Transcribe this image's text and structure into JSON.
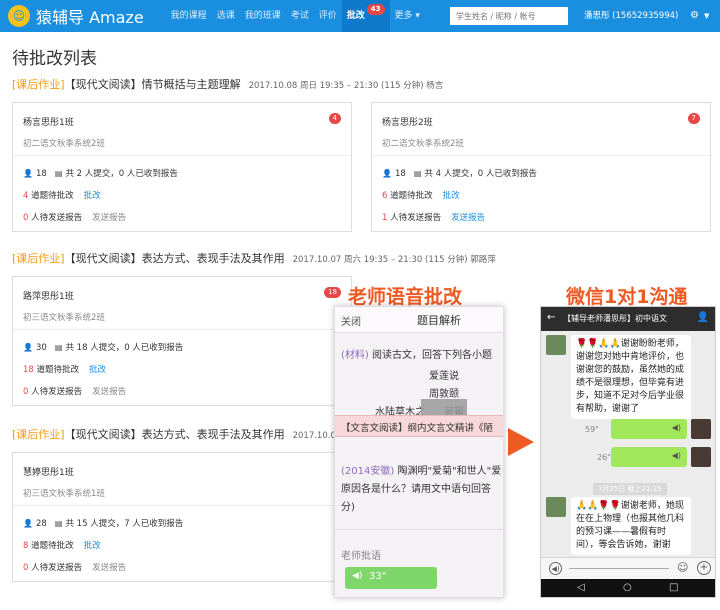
{
  "nav": {
    "logo_mark": "☺",
    "logo_text": "猿辅导 Amaze",
    "items": [
      {
        "label": "我的课程"
      },
      {
        "label": "选课"
      },
      {
        "label": "我的班课"
      },
      {
        "label": "考试"
      },
      {
        "label": "评价"
      },
      {
        "label": "批改",
        "badge": "43"
      },
      {
        "label": "更多 ▾"
      }
    ],
    "search_placeholder": "学生姓名 / 昵称 / 帐号",
    "user": "潘思彤 (15652935994)",
    "gear_icon": "gear-icon"
  },
  "page_title": "待批改列表",
  "sections": [
    {
      "tag": "[课后作业]",
      "title": "【现代文阅读】情节概括与主题理解",
      "meta": "2017.10.08 周日 19:35 – 21:30 (115 分钟)  杨言",
      "cards": [
        {
          "title": "杨言思彤1班",
          "class": "初二语文秋季系统2班",
          "badge": "4",
          "students": "18",
          "submit": "共 2 人提交，0 人已收到报告",
          "pending_num": "4",
          "pending_text": " 道题待批改",
          "grade_link": "批改",
          "send_num": "0",
          "send_text": " 人待发送报告",
          "send_link": "发送报告"
        },
        {
          "title": "杨言思彤2班",
          "class": "初二语文秋季系统2班",
          "badge": "7",
          "students": "18",
          "submit": "共 4 人提交，0 人已收到报告",
          "pending_num": "6",
          "pending_text": " 道题待批改",
          "grade_link": "批改",
          "send_num": "1",
          "send_text": " 人待发送报告",
          "send_link": "发送报告"
        }
      ]
    },
    {
      "tag": "[课后作业]",
      "title": "【现代文阅读】表达方式、表现手法及其作用",
      "meta": "2017.10.07 周六 19:35 – 21:30 (115 分钟)  郭路萍",
      "cards": [
        {
          "title": "路萍思彤1班",
          "class": "初三语文秋季系统2班",
          "badge": "18",
          "students": "30",
          "submit": "共 18 人提交，0 人已收到报告",
          "pending_num": "18",
          "pending_text": " 道题待批改",
          "grade_link": "批改",
          "send_num": "0",
          "send_text": " 人待发送报告",
          "send_link": "发送报告"
        }
      ]
    },
    {
      "tag": "[课后作业]",
      "title": "【现代文阅读】表达方式、表现手法及其作用",
      "meta": "2017.10.0",
      "cards": [
        {
          "title": "慧婷思彤1班",
          "class": "初三语文秋季系统1班",
          "badge": "",
          "students": "28",
          "submit": "共 15 人提交，7 人已收到报告",
          "pending_num": "8",
          "pending_text": " 道题待批改",
          "grade_link": "批改",
          "send_num": "0",
          "send_text": " 人待发送报告",
          "send_link": "发送报告"
        }
      ]
    }
  ],
  "overlay": {
    "label_left": "老师语音批改",
    "label_right": "微信1对1沟通",
    "left_phone": {
      "close": "关闭",
      "title": "题目解析",
      "q1_tag": "(材料)",
      "q1_text": " 阅读古文，回答下列各小题",
      "poem1": "爱莲说",
      "poem2": "周敦颐",
      "poem3": "水陆草木之",
      "poem3_tail": "甚蕃",
      "band": "【文言文阅读】纲内文言文精讲《陋",
      "q2_tag": "(2014安徽)",
      "q2_text": " 陶渊明\"爱菊\"和世人\"爱原因各是什么？请用文中语句回答分)",
      "comment": "老师批语",
      "voice": "33\""
    },
    "right_phone": {
      "title": "【辅导老师潘思彤】初中语文",
      "msg1": "🌹🌹🙏🙏谢谢盼盼老师，谢谢您对她中肯地评价，也谢谢您的鼓励，虽然她的成绩不是很理想，但毕竟有进步，知道不足对今后学业很有帮助，谢谢了",
      "voice1": "59\"",
      "voice2": "26\"",
      "timestamp": "7月25日 晚上21:25",
      "msg2": "🙏🙏🌹🌹谢谢老师，她现在在上物理（也报其他几科的预习课——暑假有时间），等会告诉她，谢谢"
    }
  }
}
